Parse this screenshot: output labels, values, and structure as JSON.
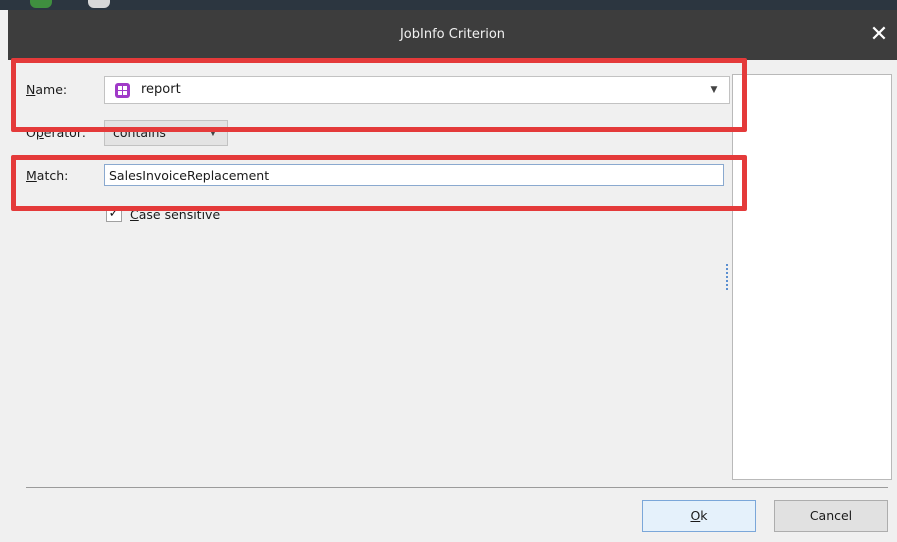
{
  "window": {
    "title": "JobInfo Criterion",
    "close_glyph": "✕"
  },
  "form": {
    "name": {
      "label_key": "N",
      "label_rest": "ame:",
      "value": "report",
      "icon": "report-icon"
    },
    "operator": {
      "label_pre": "O",
      "label_key": "p",
      "label_rest": "erator:",
      "value": "contains"
    },
    "match": {
      "label_key": "M",
      "label_rest": "atch:",
      "value": "SalesInvoiceReplacement"
    },
    "case_sensitive": {
      "checked": true,
      "check_glyph": "✓",
      "label_key": "C",
      "label_rest": "ase sensitive"
    }
  },
  "buttons": {
    "ok": {
      "label_key": "O",
      "label_rest": "k"
    },
    "cancel": {
      "label": "Cancel"
    }
  },
  "annotations": {
    "highlight_color": "#e43a3a"
  },
  "colors": {
    "title_bar": "#3d3d3d",
    "report_icon": "#a03ac8"
  }
}
